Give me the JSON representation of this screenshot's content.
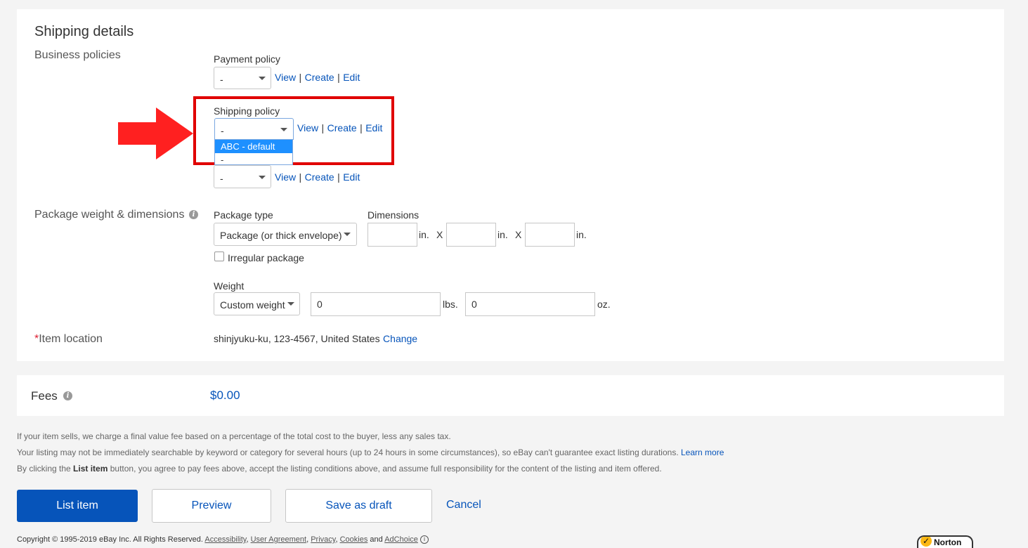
{
  "shipping": {
    "title": "Shipping details",
    "business_policies_label": "Business policies",
    "payment": {
      "label": "Payment policy",
      "value": "-",
      "view": "View",
      "create": "Create",
      "edit": "Edit",
      "sep": "|"
    },
    "shipping_policy": {
      "label": "Shipping policy",
      "value": "-",
      "view": "View",
      "create": "Create",
      "edit": "Edit",
      "sep": "|",
      "options": [
        "ABC - default",
        "-"
      ],
      "highlighted_option": "ABC - default"
    },
    "return": {
      "value": "-",
      "view": "View",
      "create": "Create",
      "edit": "Edit",
      "sep": "|"
    },
    "package": {
      "label": "Package weight & dimensions",
      "type_label": "Package type",
      "type_value": "Package (or thick envelope)",
      "dimensions_label": "Dimensions",
      "unit_in": "in.",
      "times": "X",
      "irregular_label": "Irregular package",
      "irregular_checked": false,
      "weight_label": "Weight",
      "weight_type": "Custom weight",
      "lbs_value": "0",
      "lbs_unit": "lbs.",
      "oz_value": "0",
      "oz_unit": "oz."
    },
    "location": {
      "required_mark": "*",
      "label": "Item location",
      "value": "shinjyuku-ku, 123-4567, United States",
      "change": "Change"
    }
  },
  "fees": {
    "label": "Fees",
    "amount": "$0.00"
  },
  "notes": {
    "line1": "If your item sells, we charge a final value fee based on a percentage of the total cost to the buyer, less any sales tax.",
    "line2": "Your listing may not be immediately searchable by keyword or category for several hours (up to 24 hours in some circumstances), so eBay can't guarantee exact listing durations.",
    "learn_more": "Learn more",
    "line3_pre": "By clicking the",
    "line3_bold": "List item",
    "line3_post": "button, you agree to pay fees above, accept the listing conditions above, and assume full responsibility for the content of the listing and item offered."
  },
  "actions": {
    "list_item": "List item",
    "preview": "Preview",
    "save_draft": "Save as draft",
    "cancel": "Cancel"
  },
  "footer": {
    "copyright": "Copyright © 1995-2019 eBay Inc. All Rights Reserved.",
    "accessibility": "Accessibility",
    "user_agreement": "User Agreement",
    "privacy": "Privacy",
    "cookies": "Cookies",
    "and": "and",
    "adchoice": "AdChoice",
    "comma": ",",
    "norton": "Norton"
  },
  "colors": {
    "highlight_box": "#e00000",
    "arrow": "#ff2020",
    "link": "#0654ba",
    "dropdown_selected": "#1e90ff"
  }
}
